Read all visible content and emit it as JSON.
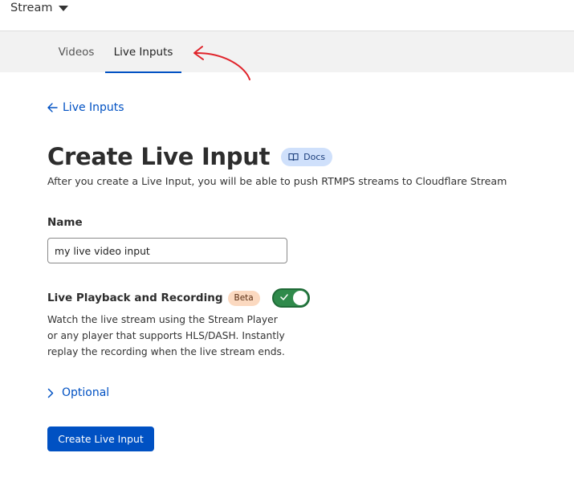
{
  "header": {
    "product_label": "Stream"
  },
  "tabs": [
    {
      "label": "Videos",
      "active": false
    },
    {
      "label": "Live Inputs",
      "active": true
    }
  ],
  "back_link": {
    "label": "Live Inputs"
  },
  "title": {
    "text": "Create Live Input",
    "docs_label": "Docs"
  },
  "subtitle": "After you create a Live Input, you will be able to push RTMPS streams to Cloudflare Stream",
  "name_field": {
    "label": "Name",
    "value": "my live video input"
  },
  "playback": {
    "label": "Live Playback and Recording",
    "badge": "Beta",
    "enabled": true,
    "description": "Watch the live stream using the Stream Player or any player that supports HLS/DASH. Instantly replay the recording when the live stream ends."
  },
  "optional": {
    "label": "Optional"
  },
  "create_button": {
    "label": "Create Live Input"
  },
  "colors": {
    "accent": "#0051c3",
    "toggle_on": "#2f8a4b",
    "annotation": "#e0242b",
    "docs_badge_bg": "#cfe0fb",
    "beta_badge_bg": "#fbd9c0"
  },
  "icons": {
    "dropdown": "caret-down-icon",
    "back": "arrow-left-icon",
    "docs": "book-icon",
    "toggle": "check-icon",
    "optional": "chevron-right-icon"
  }
}
